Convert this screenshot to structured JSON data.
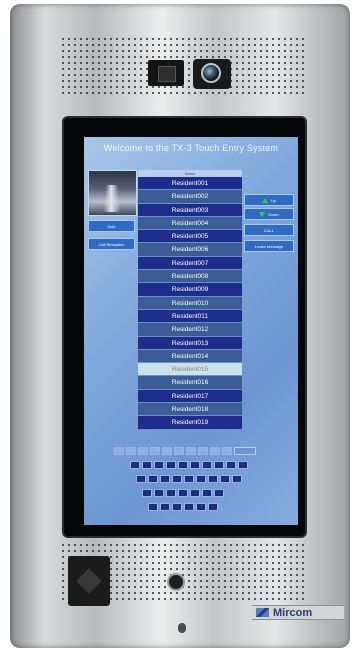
{
  "screen": {
    "welcome": "Welcome to the TX-3 Touch Entry System",
    "left_buttons": [
      "Help",
      "Call Reception"
    ],
    "list_header": "Name",
    "residents": [
      "Resident001",
      "Resident002",
      "Resident003",
      "Resident004",
      "Resident005",
      "Resident006",
      "Resident007",
      "Resident008",
      "Resident009",
      "Resident010",
      "Resident011",
      "Resident012",
      "Resident013",
      "Resident014",
      "Resident015",
      "Resident016",
      "Resident017",
      "Resident018",
      "Resident019"
    ],
    "selected_resident": "Resident015",
    "right_buttons": {
      "up": "Up",
      "down": "Down",
      "call": "CALL",
      "leave_message": "Leave Message"
    }
  },
  "device": {
    "brand": "Mircom"
  },
  "colors": {
    "accent": "#2f6bc5",
    "list_row": "#1e2d8c",
    "list_row_alt": "#3a5d95",
    "selected_row": "#c9e2ee"
  },
  "icons": [
    "camera-icon",
    "lens-icon",
    "card-reader-icon",
    "microphone-icon",
    "up-arrow-icon",
    "down-arrow-icon",
    "mircom-logo"
  ]
}
